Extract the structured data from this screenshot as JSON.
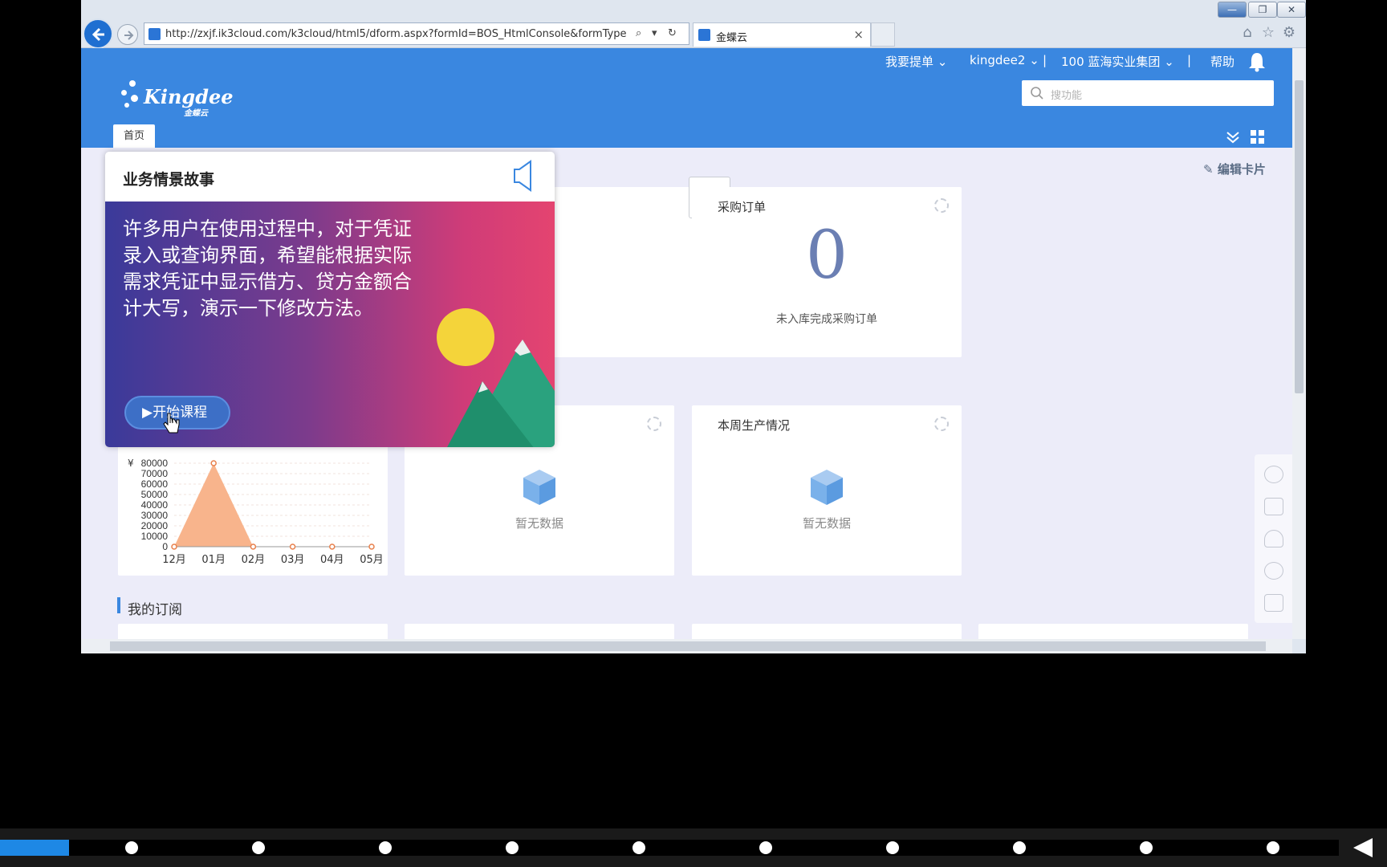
{
  "browser": {
    "url": "http://zxjf.ik3cloud.com/k3cloud/html5/dform.aspx?formId=BOS_HtmlConsole&formType=",
    "tab_title": "金蝶云",
    "tab_close": "×"
  },
  "header": {
    "logo_text": "Kingdee",
    "logo_sub": "金蝶云",
    "menu": {
      "submit_ticket": "我要提单",
      "user": "kingdee2",
      "org": "100 蓝海实业集团",
      "help": "帮助"
    },
    "search_placeholder": "搜功能",
    "home_tab": "首页"
  },
  "dashboard": {
    "edit_cards": "编辑卡片",
    "purchase_card": {
      "title": "采购订单",
      "value": "0",
      "caption": "未入库完成采购订单"
    },
    "production_card": {
      "title": "本周生产情况",
      "nodata": "暂无数据"
    },
    "middle_card": {
      "nodata": "暂无数据"
    },
    "subscriptions_title": "我的订阅"
  },
  "popup": {
    "title": "业务情景故事",
    "body": "许多用户在使用过程中，对于凭证录入或查询界面，希望能根据实际需求凭证中显示借方、贷方金额合计大写，演示一下修改方法。",
    "start_button": "开始课程"
  },
  "chart_data": {
    "type": "area",
    "categories": [
      "12月",
      "01月",
      "02月",
      "03月",
      "04月",
      "05月"
    ],
    "values": [
      0,
      80000,
      0,
      0,
      0,
      0
    ],
    "y_ticks": [
      "80000",
      "70000",
      "60000",
      "50000",
      "40000",
      "30000",
      "20000",
      "10000",
      "0"
    ],
    "y_prefix": "¥",
    "ylim": [
      0,
      80000
    ],
    "color": "#f8b48c"
  },
  "colors": {
    "header_blue": "#3a87e0",
    "page_bg": "#ececf9",
    "progress_blue": "#1e88e5"
  }
}
